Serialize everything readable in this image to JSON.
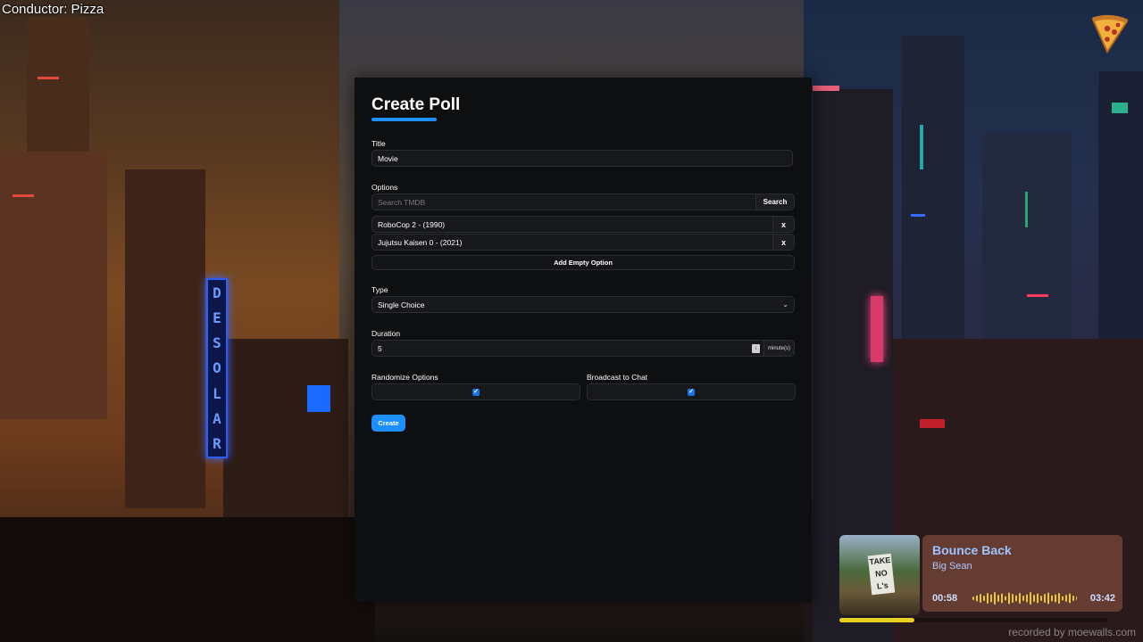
{
  "overlay": {
    "conductor": "Conductor: Pizza",
    "watermark": "recorded by moewalls.com",
    "neon_sign": [
      "D",
      "E",
      "S",
      "O",
      "L",
      "A",
      "R"
    ]
  },
  "poll": {
    "heading": "Create Poll",
    "title_label": "Title",
    "title_value": "Movie",
    "options_label": "Options",
    "search_placeholder": "Search TMDB",
    "search_button": "Search",
    "options": [
      {
        "text": "RoboCop 2 - (1990)",
        "remove": "x"
      },
      {
        "text": "Jujutsu Kaisen 0 - (2021)",
        "remove": "x"
      }
    ],
    "add_empty_option": "Add Empty Option",
    "type_label": "Type",
    "type_value": "Single Choice",
    "duration_label": "Duration",
    "duration_value": "5",
    "duration_unit": "minute(s)",
    "randomize_label": "Randomize Options",
    "randomize_checked": true,
    "broadcast_label": "Broadcast to Chat",
    "broadcast_checked": true,
    "create_button": "Create",
    "accent_color": "#1e90ff"
  },
  "now_playing": {
    "title": "Bounce Back",
    "artist": "Big Sean",
    "current_time": "00:58",
    "total_time": "03:42",
    "album_sign": "TAKE NO L's",
    "progress": 0.28,
    "progress_color": "#e8d020"
  }
}
